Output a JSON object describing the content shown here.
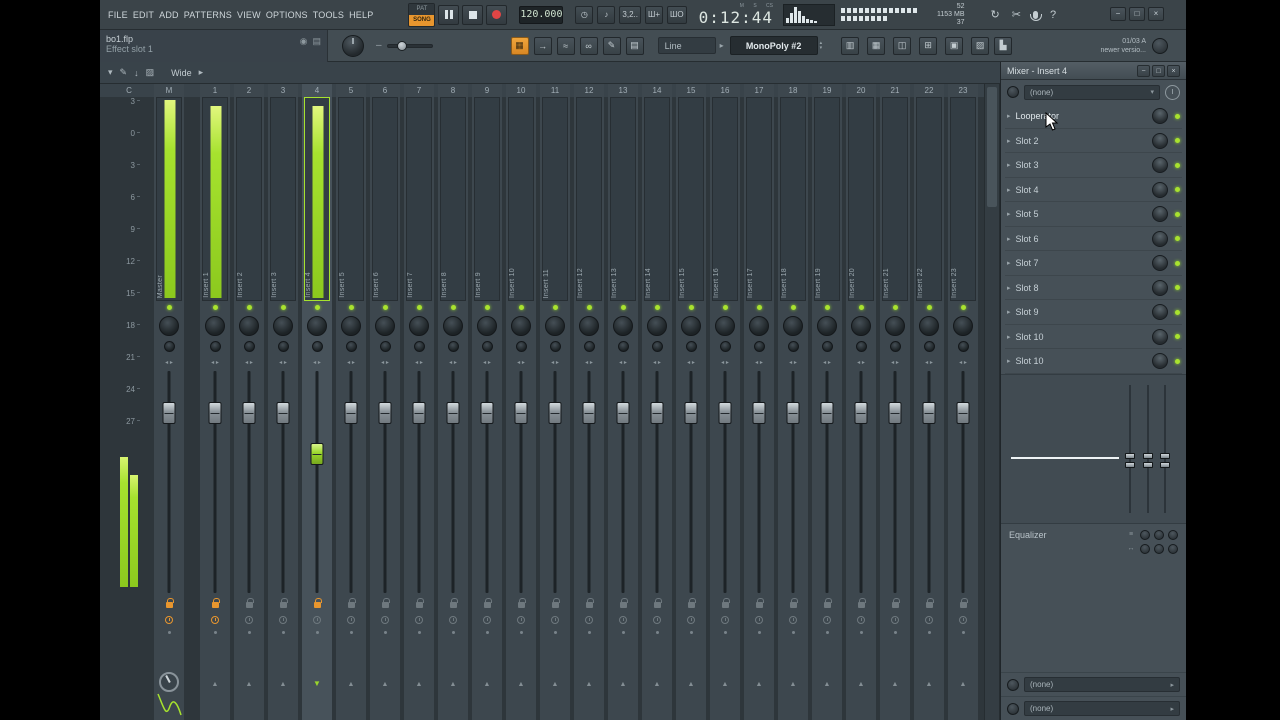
{
  "colors": {
    "green": "#a6e22e",
    "orange": "#e8962e",
    "red": "#e04545"
  },
  "window_buttons": {
    "minimize": "−",
    "maximize": "□",
    "close": "×"
  },
  "menubar": {
    "items": [
      "FILE",
      "EDIT",
      "ADD",
      "PATTERNS",
      "VIEW",
      "OPTIONS",
      "TOOLS",
      "HELP"
    ],
    "pat_label": "PAT",
    "song_label": "SONG",
    "tempo": "120.000",
    "time_units": "M S CS",
    "time_value": "0:12:44",
    "cpu_value": "52",
    "mem_value": "1153 MB",
    "voices_value": "37",
    "metro_icons": [
      {
        "glyph": "◷"
      },
      {
        "glyph": "♪"
      },
      {
        "glyph": "3,2.."
      },
      {
        "glyph": "Ш+"
      },
      {
        "glyph": "ШО"
      }
    ],
    "icons": {
      "sync": "↻",
      "cut": "✂",
      "help": "?"
    }
  },
  "toolbar2": {
    "file_name": "bo1.flp",
    "hint_text": "Effect slot 1",
    "minus": "–",
    "line_label": "Line",
    "instrument_label": "MonoPoly #2",
    "version_line1": "01/03 A",
    "version_line2": "newer versio...",
    "icons": {
      "disc": "◉",
      "piano": "▤",
      "pattern": "▦",
      "arrow": "→",
      "slide": "≈",
      "link": "∞",
      "brush": "✎",
      "rack": "▤",
      "prev": "◂",
      "next": "▸",
      "up": "▴",
      "down": "▾",
      "view_glyphs": [
        "▥",
        "▦",
        "◫",
        "⊞",
        "▣",
        "▨"
      ],
      "graph": "▙"
    }
  },
  "mixer": {
    "toolbar": {
      "wide_label": "Wide",
      "icons": {
        "menu": "▾",
        "paint": "✎",
        "detach": "↓",
        "dock": "▨",
        "arrow": "▸"
      }
    },
    "ruler_header": "C",
    "ruler": [
      "3",
      "0",
      "3",
      "6",
      "9",
      "12",
      "15",
      "18",
      "21",
      "24",
      "27"
    ],
    "channels": [
      {
        "num": "M",
        "label": "Master",
        "meter": 0.98,
        "fader": 0.16,
        "armed": true,
        "clock": true,
        "master": true
      },
      {
        "num": "1",
        "label": "Insert 1",
        "meter": 0.95,
        "fader": 0.16,
        "armed": true,
        "clock": true
      },
      {
        "num": "2",
        "label": "Insert 2",
        "meter": 0,
        "fader": 0.16
      },
      {
        "num": "3",
        "label": "Insert 3",
        "meter": 0,
        "fader": 0.16
      },
      {
        "num": "4",
        "label": "Insert 4",
        "meter": 0.95,
        "fader": 0.36,
        "selected": true,
        "armed": true
      },
      {
        "num": "5",
        "label": "Insert 5",
        "meter": 0,
        "fader": 0.16
      },
      {
        "num": "6",
        "label": "Insert 6",
        "meter": 0,
        "fader": 0.16
      },
      {
        "num": "7",
        "label": "Insert 7",
        "meter": 0,
        "fader": 0.16
      },
      {
        "num": "8",
        "label": "Insert 8",
        "meter": 0,
        "fader": 0.16
      },
      {
        "num": "9",
        "label": "Insert 9",
        "meter": 0,
        "fader": 0.16
      },
      {
        "num": "10",
        "label": "Insert 10",
        "meter": 0,
        "fader": 0.16
      },
      {
        "num": "11",
        "label": "Insert 11",
        "meter": 0,
        "fader": 0.16
      },
      {
        "num": "12",
        "label": "Insert 12",
        "meter": 0,
        "fader": 0.16
      },
      {
        "num": "13",
        "label": "Insert 13",
        "meter": 0,
        "fader": 0.16
      },
      {
        "num": "14",
        "label": "Insert 14",
        "meter": 0,
        "fader": 0.16
      },
      {
        "num": "15",
        "label": "Insert 15",
        "meter": 0,
        "fader": 0.16
      },
      {
        "num": "16",
        "label": "Insert 16",
        "meter": 0,
        "fader": 0.16
      },
      {
        "num": "17",
        "label": "Insert 17",
        "meter": 0,
        "fader": 0.16
      },
      {
        "num": "18",
        "label": "Insert 18",
        "meter": 0,
        "fader": 0.16
      },
      {
        "num": "19",
        "label": "Insert 19",
        "meter": 0,
        "fader": 0.16
      },
      {
        "num": "20",
        "label": "Insert 20",
        "meter": 0,
        "fader": 0.16
      },
      {
        "num": "21",
        "label": "Insert 21",
        "meter": 0,
        "fader": 0.16
      },
      {
        "num": "22",
        "label": "Insert 22",
        "meter": 0,
        "fader": 0.16
      },
      {
        "num": "23",
        "label": "Insert 23",
        "meter": 0,
        "fader": 0.16
      }
    ]
  },
  "panel": {
    "title": "Mixer - Insert 4",
    "plugin_dropdown": "(none)",
    "slots": [
      {
        "label": "Looperator"
      },
      {
        "label": "Slot 2"
      },
      {
        "label": "Slot 3"
      },
      {
        "label": "Slot 4"
      },
      {
        "label": "Slot 5"
      },
      {
        "label": "Slot 6"
      },
      {
        "label": "Slot 7"
      },
      {
        "label": "Slot 8"
      },
      {
        "label": "Slot 9"
      },
      {
        "label": "Slot 10"
      },
      {
        "label": "Slot 10"
      }
    ],
    "equalizer_label": "Equalizer",
    "eq_icons": {
      "rows": "≡",
      "width": "↔"
    },
    "send_dropdown1": "(none)",
    "send_dropdown2": "(none)"
  }
}
